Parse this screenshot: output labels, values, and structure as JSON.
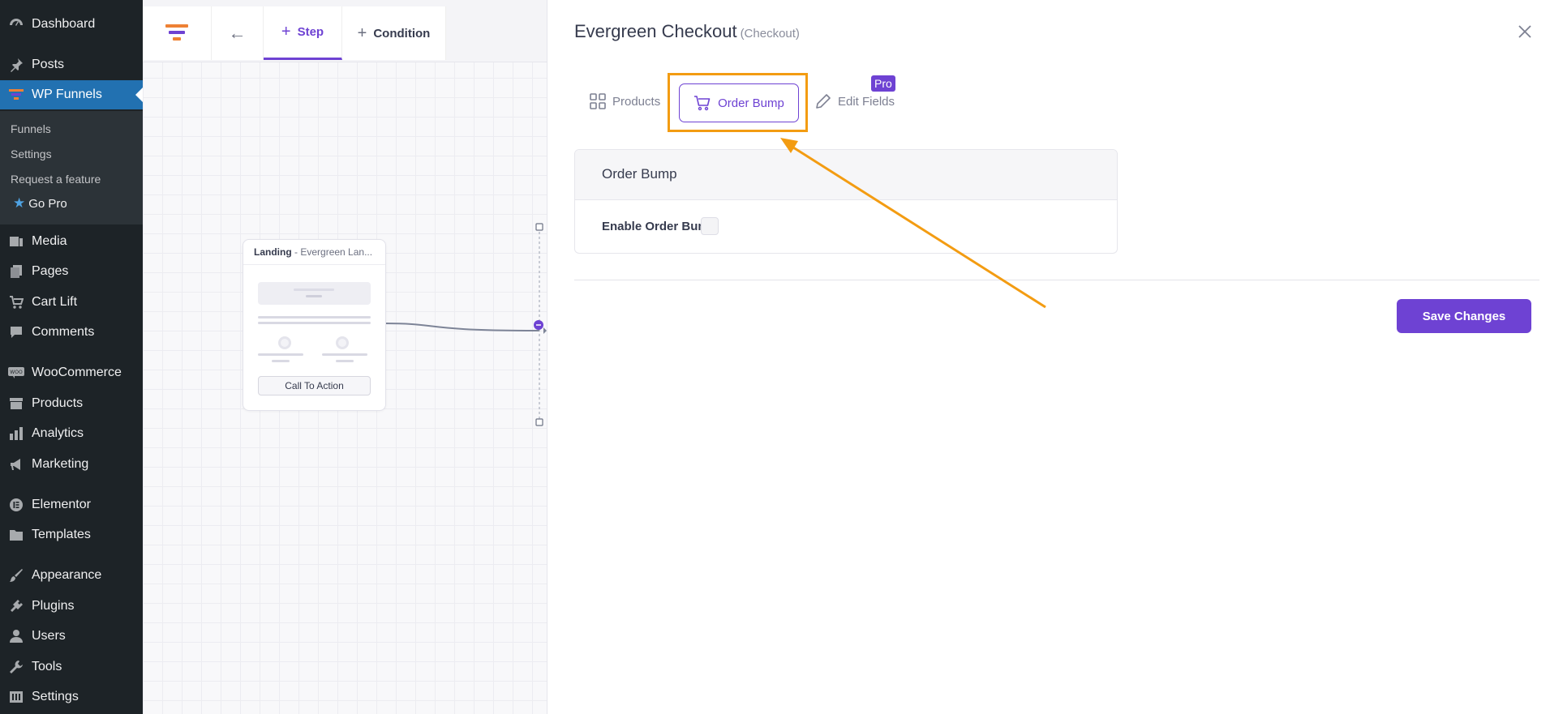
{
  "wp_menu": {
    "dashboard": "Dashboard",
    "posts": "Posts",
    "wp_funnels": "WP Funnels",
    "submenu": {
      "funnels": "Funnels",
      "settings": "Settings",
      "request_feature": "Request a feature",
      "go_pro": "Go Pro"
    },
    "media": "Media",
    "pages": "Pages",
    "cart_lift": "Cart Lift",
    "comments": "Comments",
    "woocommerce": "WooCommerce",
    "products": "Products",
    "analytics": "Analytics",
    "marketing": "Marketing",
    "elementor": "Elementor",
    "templates": "Templates",
    "appearance": "Appearance",
    "plugins": "Plugins",
    "users": "Users",
    "tools": "Tools",
    "settings": "Settings"
  },
  "canvas": {
    "toolbar": {
      "step_label": "Step",
      "condition_label": "Condition"
    },
    "node": {
      "type": "Landing",
      "name": "- Evergreen Lan...",
      "cta": "Call To Action"
    }
  },
  "panel": {
    "title": "Evergreen Checkout",
    "type": "(Checkout)",
    "tabs": {
      "products": "Products",
      "order_bump": "Order Bump",
      "edit_fields": "Edit Fields",
      "pro_badge": "Pro"
    },
    "order_bump_card": {
      "title": "Order Bump",
      "enable_label": "Enable Order Bump",
      "enabled": false
    },
    "save_label": "Save Changes"
  },
  "colors": {
    "brand": "#6e42d3",
    "highlight": "#f39c12",
    "wp_sidebar": "#1d2327",
    "wp_active": "#2271b1"
  }
}
